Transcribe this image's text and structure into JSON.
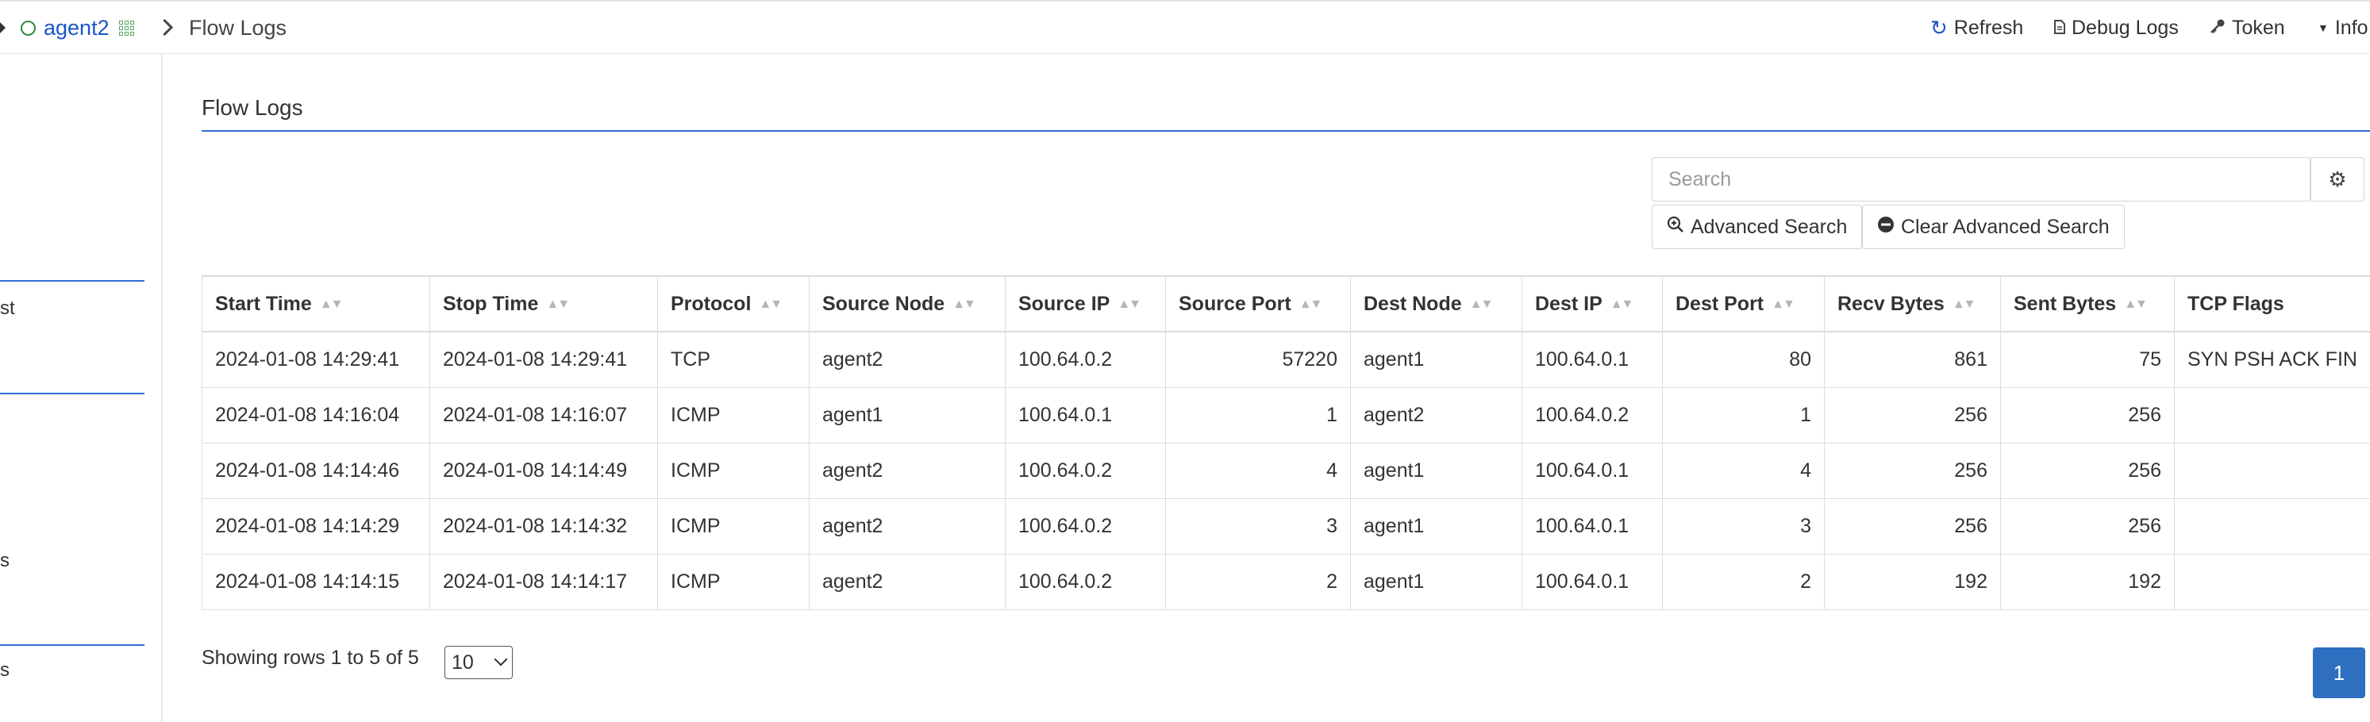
{
  "breadcrumb": {
    "agent": "agent2",
    "current": "Flow Logs"
  },
  "toolbar": {
    "refresh": "Refresh",
    "debug_logs": "Debug Logs",
    "token": "Token",
    "info": "Info"
  },
  "sidebar": {
    "fragments": [
      "st",
      "s",
      "s"
    ]
  },
  "page": {
    "title": "Flow Logs"
  },
  "search": {
    "placeholder": "Search",
    "advanced": "Advanced Search",
    "clear_advanced": "Clear Advanced Search"
  },
  "table": {
    "columns": [
      "Start Time",
      "Stop Time",
      "Protocol",
      "Source Node",
      "Source IP",
      "Source Port",
      "Dest Node",
      "Dest IP",
      "Dest Port",
      "Recv Bytes",
      "Sent Bytes",
      "TCP Flags"
    ],
    "rows": [
      [
        "2024-01-08 14:29:41",
        "2024-01-08 14:29:41",
        "TCP",
        "agent2",
        "100.64.0.2",
        "57220",
        "agent1",
        "100.64.0.1",
        "80",
        "861",
        "75",
        "SYN PSH ACK FIN"
      ],
      [
        "2024-01-08 14:16:04",
        "2024-01-08 14:16:07",
        "ICMP",
        "agent1",
        "100.64.0.1",
        "1",
        "agent2",
        "100.64.0.2",
        "1",
        "256",
        "256",
        ""
      ],
      [
        "2024-01-08 14:14:46",
        "2024-01-08 14:14:49",
        "ICMP",
        "agent2",
        "100.64.0.2",
        "4",
        "agent1",
        "100.64.0.1",
        "4",
        "256",
        "256",
        ""
      ],
      [
        "2024-01-08 14:14:29",
        "2024-01-08 14:14:32",
        "ICMP",
        "agent2",
        "100.64.0.2",
        "3",
        "agent1",
        "100.64.0.1",
        "3",
        "256",
        "256",
        ""
      ],
      [
        "2024-01-08 14:14:15",
        "2024-01-08 14:14:17",
        "ICMP",
        "agent2",
        "100.64.0.2",
        "2",
        "agent1",
        "100.64.0.1",
        "2",
        "192",
        "192",
        ""
      ]
    ]
  },
  "pagination": {
    "summary": "Showing rows 1 to 5 of 5",
    "page_size": "10",
    "current_page": "1"
  },
  "colors": {
    "accent": "#2f6fd6",
    "primary_button": "#2f6fbf",
    "link": "#1a56c8",
    "status_ok": "#2e8b3a"
  }
}
